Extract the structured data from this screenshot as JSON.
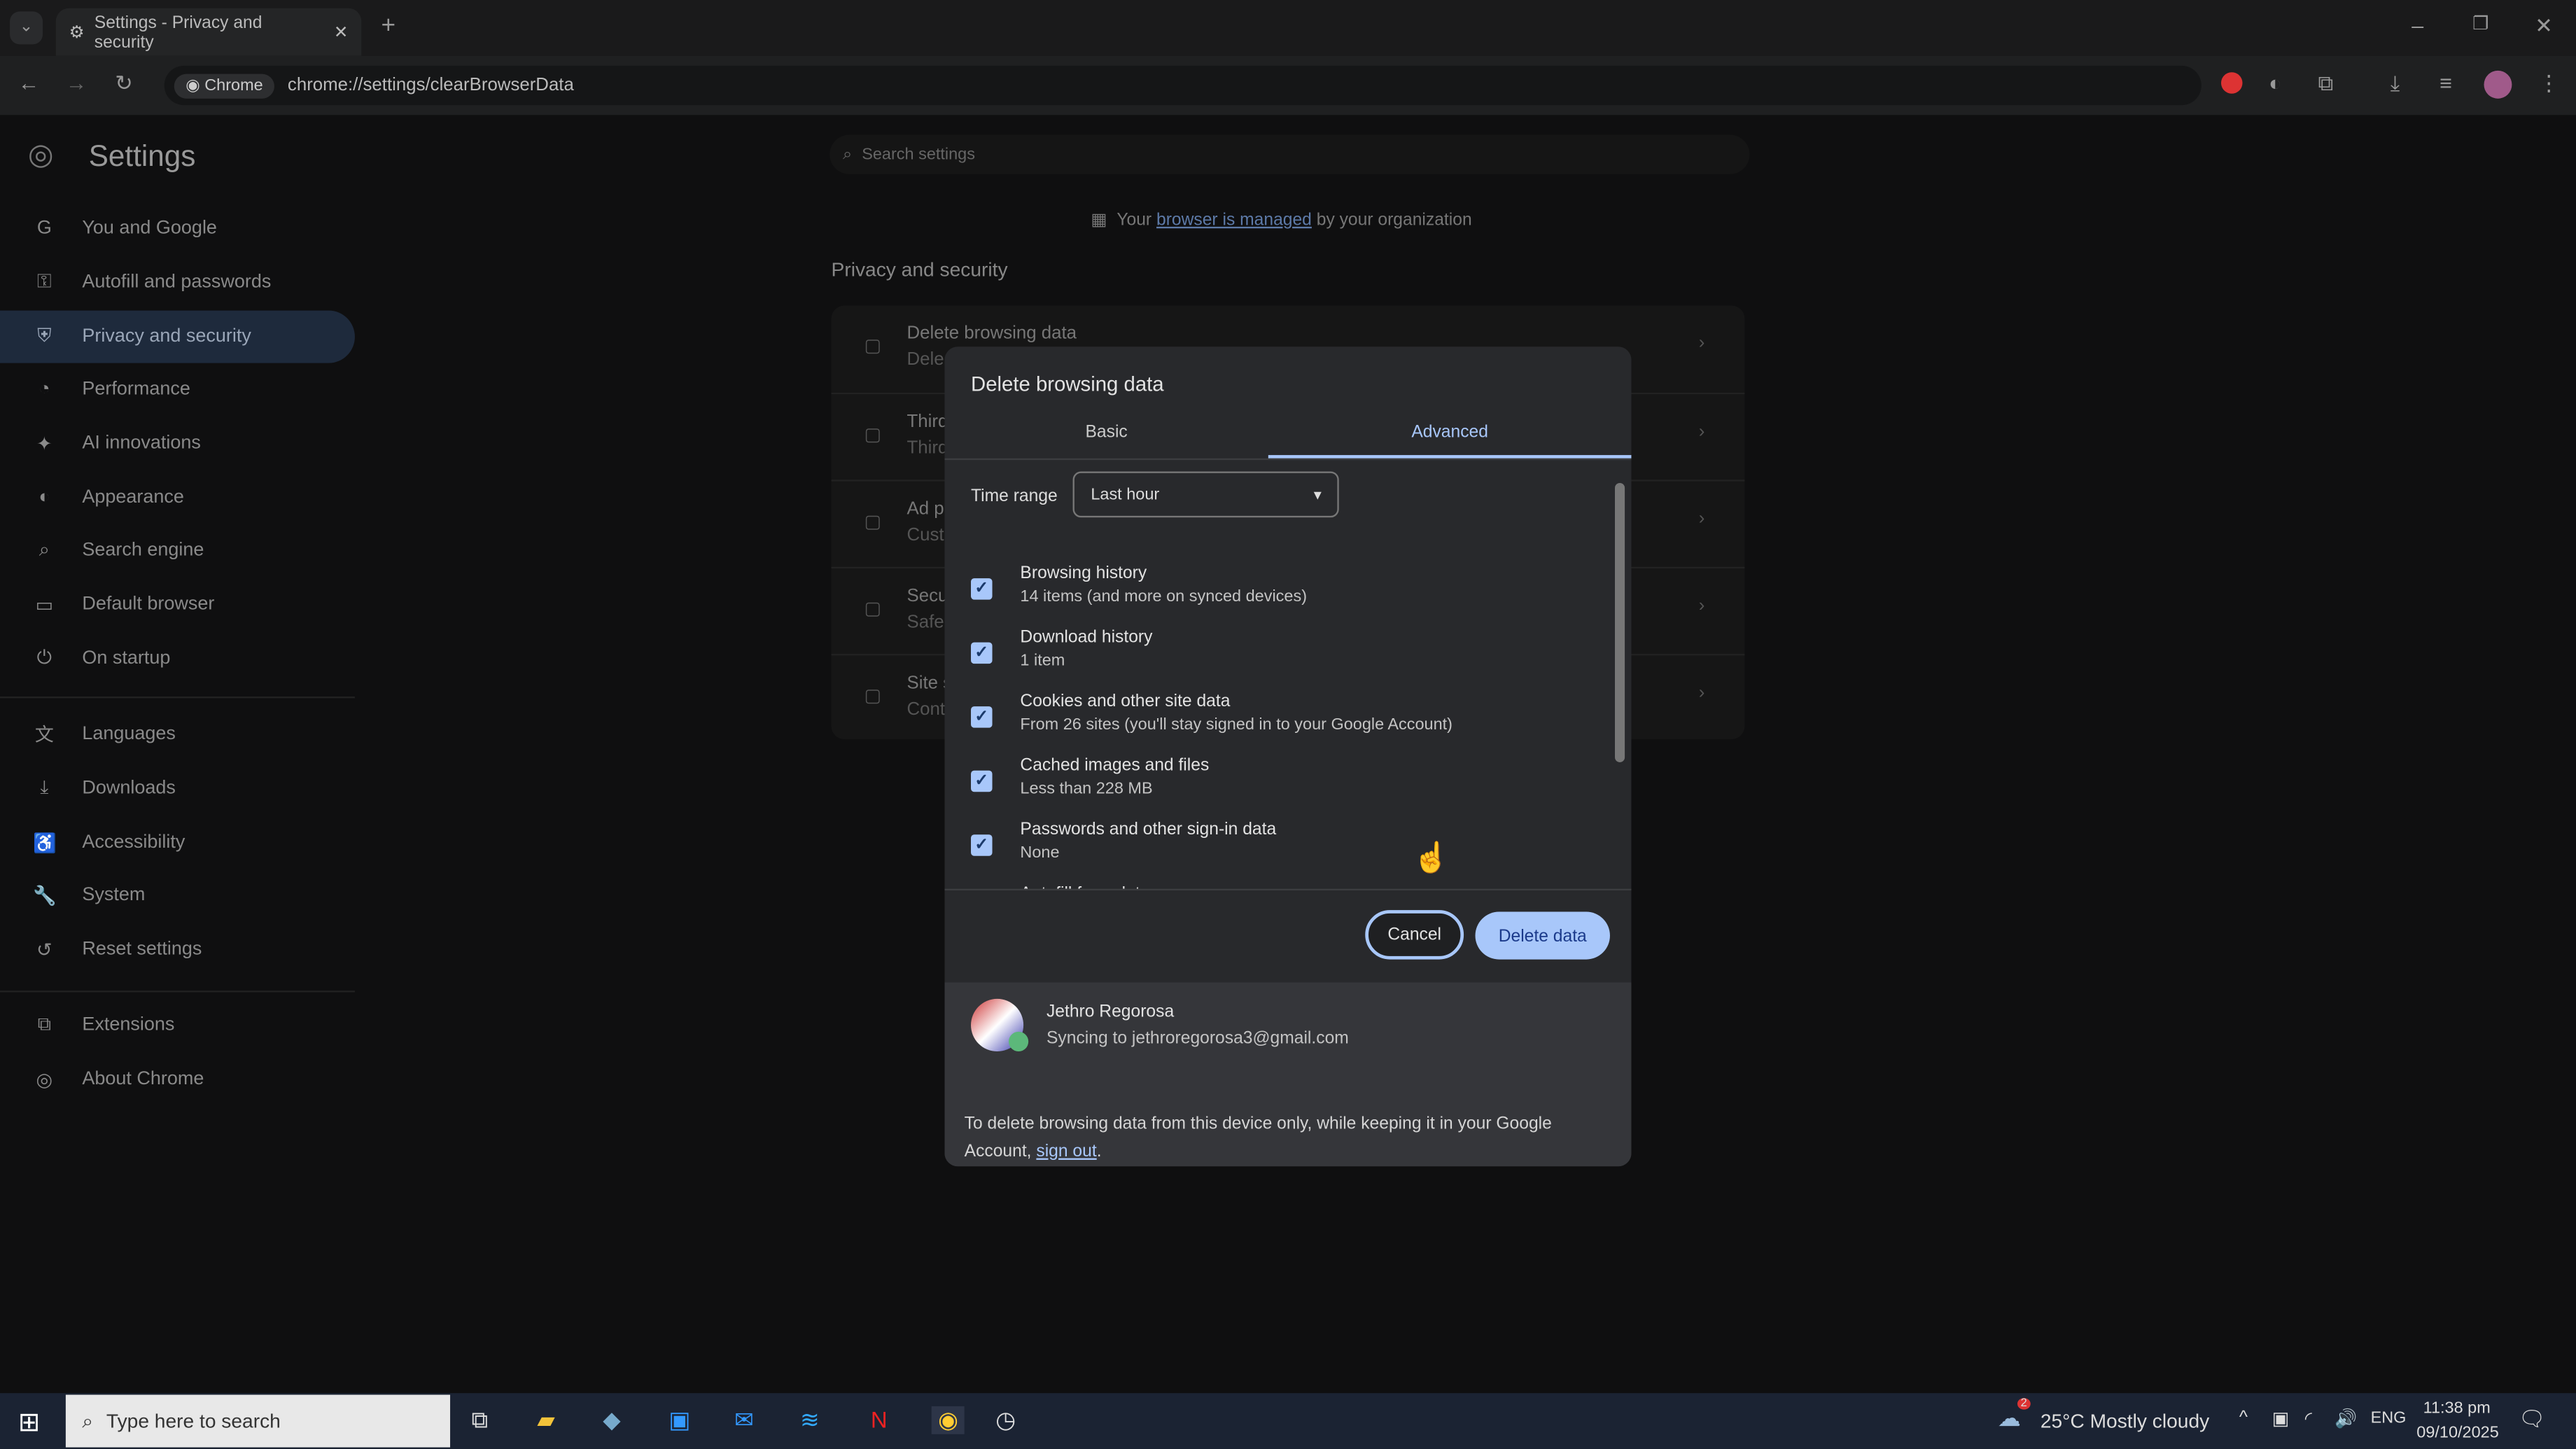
{
  "browser": {
    "tab_title": "Settings - Privacy and security",
    "chip": "Chrome",
    "url": "chrome://settings/clearBrowserData"
  },
  "settings": {
    "title": "Settings",
    "search_placeholder": "Search settings",
    "managed_pre": "Your ",
    "managed_link": "browser is managed",
    "managed_post": " by your organization",
    "section": "Privacy and security",
    "rows": [
      {
        "title": "Delete browsing data",
        "sub": "Dele"
      },
      {
        "title": "Third",
        "sub": "Third"
      },
      {
        "title": "Ad p",
        "sub": "Cust"
      },
      {
        "title": "Secu",
        "sub": "Safe"
      },
      {
        "title": "Site s",
        "sub": "Cont"
      }
    ],
    "sidebar": [
      {
        "label": "You and Google",
        "icon": "G"
      },
      {
        "label": "Autofill and passwords",
        "icon": "⚿"
      },
      {
        "label": "Privacy and security",
        "icon": "⛨"
      },
      {
        "label": "Performance",
        "icon": "◔"
      },
      {
        "label": "AI innovations",
        "icon": "✦"
      },
      {
        "label": "Appearance",
        "icon": "◐"
      },
      {
        "label": "Search engine",
        "icon": "⌕"
      },
      {
        "label": "Default browser",
        "icon": "▭"
      },
      {
        "label": "On startup",
        "icon": "⏻"
      },
      {
        "label": "Languages",
        "icon": "文"
      },
      {
        "label": "Downloads",
        "icon": "⤓"
      },
      {
        "label": "Accessibility",
        "icon": "♿"
      },
      {
        "label": "System",
        "icon": "🔧"
      },
      {
        "label": "Reset settings",
        "icon": "↺"
      },
      {
        "label": "Extensions",
        "icon": "⧉"
      },
      {
        "label": "About Chrome",
        "icon": "◎"
      }
    ]
  },
  "dialog": {
    "title": "Delete browsing data",
    "tabs": [
      "Basic",
      "Advanced"
    ],
    "time_range_label": "Time range",
    "time_range_value": "Last hour",
    "items": [
      {
        "title": "Browsing history",
        "sub": "14 items (and more on synced devices)",
        "checked": true
      },
      {
        "title": "Download history",
        "sub": "1 item",
        "checked": true
      },
      {
        "title": "Cookies and other site data",
        "sub": "From 26 sites (you'll stay signed in to your Google Account)",
        "checked": true
      },
      {
        "title": "Cached images and files",
        "sub": "Less than 228 MB",
        "checked": true
      },
      {
        "title": "Passwords and other sign-in data",
        "sub": "None",
        "checked": true
      },
      {
        "title": "Autofill form data",
        "sub": "",
        "checked": true
      }
    ],
    "cancel": "Cancel",
    "delete": "Delete data",
    "account_name": "Jethro Regorosa",
    "account_sync": "Syncing to jethroregorosa3@gmail.com",
    "footer_text": "To delete browsing data from this device only, while keeping it in your Google Account, ",
    "footer_link": "sign out",
    "footer_end": "."
  },
  "taskbar": {
    "search_placeholder": "Type here to search",
    "weather": "25°C  Mostly cloudy",
    "weather_badge": "2",
    "lang": "ENG",
    "time": "11:38 pm",
    "date": "09/10/2025"
  },
  "colors": {
    "accent": "#a8c7fa",
    "dialog_bg": "#28292c"
  }
}
